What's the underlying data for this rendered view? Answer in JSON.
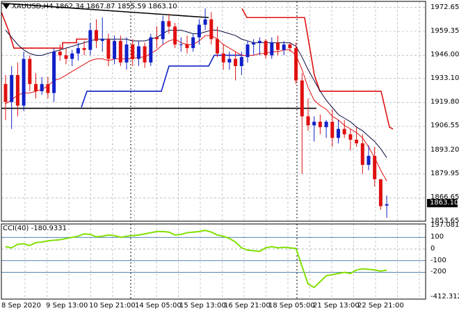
{
  "chart_title": {
    "symbol_tf": "XAUUSD,H4",
    "ohlc": "1862.34 1867.87 1855.59 1863.10"
  },
  "current_price_label": "1863.10",
  "price_axis": [
    "1972.65",
    "1959.35",
    "1946.00",
    "1933.10",
    "1919.80",
    "1906.55",
    "1893.20",
    "1879.95",
    "1866.65",
    "1853.65"
  ],
  "cci_title": "CCI(40) -180.9331",
  "cci_axis": [
    "197.0814",
    "100",
    "0",
    "-100",
    "-200",
    "-412.3125"
  ],
  "time_axis": [
    "8 Sep 2020",
    "9 Sep 13:00",
    "10 Sep 21:00",
    "14 Sep 05:00",
    "15 Sep 13:00",
    "16 Sep 21:00",
    "18 Sep 05:00",
    "21 Sep 13:00",
    "22 Sep 21:00"
  ],
  "colors": {
    "bull": "#1020c8",
    "bear": "#e01010",
    "ma_fast": "#e01010",
    "ma_slow": "#0a0a40",
    "support": "#1020c8",
    "cci": "#80e000",
    "levels": "#1c5a9a"
  },
  "chart_data": {
    "type": "candlestick",
    "symbol": "XAUUSD",
    "timeframe": "H4",
    "ylim": [
      1853.65,
      1975
    ],
    "candles": [
      {
        "o": 1930,
        "h": 1935,
        "l": 1910,
        "c": 1920
      },
      {
        "o": 1920,
        "h": 1940,
        "l": 1905,
        "c": 1935
      },
      {
        "o": 1935,
        "h": 1942,
        "l": 1912,
        "c": 1918
      },
      {
        "o": 1918,
        "h": 1948,
        "l": 1915,
        "c": 1944
      },
      {
        "o": 1944,
        "h": 1946,
        "l": 1926,
        "c": 1930
      },
      {
        "o": 1930,
        "h": 1936,
        "l": 1922,
        "c": 1926
      },
      {
        "o": 1926,
        "h": 1934,
        "l": 1924,
        "c": 1930
      },
      {
        "o": 1930,
        "h": 1934,
        "l": 1922,
        "c": 1925
      },
      {
        "o": 1925,
        "h": 1950,
        "l": 1920,
        "c": 1948
      },
      {
        "o": 1948,
        "h": 1952,
        "l": 1943,
        "c": 1946
      },
      {
        "o": 1946,
        "h": 1950,
        "l": 1941,
        "c": 1944
      },
      {
        "o": 1944,
        "h": 1949,
        "l": 1940,
        "c": 1947
      },
      {
        "o": 1947,
        "h": 1953,
        "l": 1943,
        "c": 1950
      },
      {
        "o": 1950,
        "h": 1954,
        "l": 1946,
        "c": 1949
      },
      {
        "o": 1949,
        "h": 1964,
        "l": 1946,
        "c": 1960
      },
      {
        "o": 1960,
        "h": 1966,
        "l": 1950,
        "c": 1954
      },
      {
        "o": 1954,
        "h": 1967,
        "l": 1948,
        "c": 1955
      },
      {
        "o": 1955,
        "h": 1958,
        "l": 1940,
        "c": 1944
      },
      {
        "o": 1944,
        "h": 1957,
        "l": 1941,
        "c": 1954
      },
      {
        "o": 1954,
        "h": 1957,
        "l": 1940,
        "c": 1942
      },
      {
        "o": 1942,
        "h": 1956,
        "l": 1938,
        "c": 1952
      },
      {
        "o": 1952,
        "h": 1955,
        "l": 1940,
        "c": 1944
      },
      {
        "o": 1944,
        "h": 1954,
        "l": 1940,
        "c": 1951
      },
      {
        "o": 1951,
        "h": 1953,
        "l": 1939,
        "c": 1942
      },
      {
        "o": 1942,
        "h": 1958,
        "l": 1940,
        "c": 1956
      },
      {
        "o": 1956,
        "h": 1962,
        "l": 1950,
        "c": 1955
      },
      {
        "o": 1955,
        "h": 1968,
        "l": 1952,
        "c": 1965
      },
      {
        "o": 1965,
        "h": 1969,
        "l": 1958,
        "c": 1962
      },
      {
        "o": 1962,
        "h": 1964,
        "l": 1950,
        "c": 1952
      },
      {
        "o": 1952,
        "h": 1956,
        "l": 1948,
        "c": 1952
      },
      {
        "o": 1952,
        "h": 1957,
        "l": 1947,
        "c": 1950
      },
      {
        "o": 1950,
        "h": 1958,
        "l": 1948,
        "c": 1956
      },
      {
        "o": 1956,
        "h": 1966,
        "l": 1952,
        "c": 1963
      },
      {
        "o": 1963,
        "h": 1972,
        "l": 1960,
        "c": 1966
      },
      {
        "o": 1966,
        "h": 1970,
        "l": 1952,
        "c": 1955
      },
      {
        "o": 1955,
        "h": 1962,
        "l": 1945,
        "c": 1947
      },
      {
        "o": 1947,
        "h": 1952,
        "l": 1938,
        "c": 1942
      },
      {
        "o": 1942,
        "h": 1948,
        "l": 1938,
        "c": 1944
      },
      {
        "o": 1944,
        "h": 1948,
        "l": 1932,
        "c": 1940
      },
      {
        "o": 1940,
        "h": 1948,
        "l": 1935,
        "c": 1945
      },
      {
        "o": 1945,
        "h": 1954,
        "l": 1942,
        "c": 1952
      },
      {
        "o": 1952,
        "h": 1955,
        "l": 1946,
        "c": 1953
      },
      {
        "o": 1953,
        "h": 1956,
        "l": 1946,
        "c": 1954
      },
      {
        "o": 1954,
        "h": 1955,
        "l": 1944,
        "c": 1946
      },
      {
        "o": 1946,
        "h": 1956,
        "l": 1944,
        "c": 1953
      },
      {
        "o": 1953,
        "h": 1957,
        "l": 1946,
        "c": 1949
      },
      {
        "o": 1949,
        "h": 1954,
        "l": 1946,
        "c": 1952
      },
      {
        "o": 1952,
        "h": 1953,
        "l": 1948,
        "c": 1950
      },
      {
        "o": 1950,
        "h": 1953,
        "l": 1930,
        "c": 1932
      },
      {
        "o": 1932,
        "h": 1936,
        "l": 1880,
        "c": 1912
      },
      {
        "o": 1912,
        "h": 1922,
        "l": 1904,
        "c": 1907
      },
      {
        "o": 1907,
        "h": 1912,
        "l": 1898,
        "c": 1909
      },
      {
        "o": 1909,
        "h": 1913,
        "l": 1902,
        "c": 1906
      },
      {
        "o": 1906,
        "h": 1910,
        "l": 1900,
        "c": 1909
      },
      {
        "o": 1909,
        "h": 1916,
        "l": 1895,
        "c": 1900
      },
      {
        "o": 1900,
        "h": 1910,
        "l": 1897,
        "c": 1905
      },
      {
        "o": 1905,
        "h": 1910,
        "l": 1900,
        "c": 1902
      },
      {
        "o": 1902,
        "h": 1905,
        "l": 1893,
        "c": 1899
      },
      {
        "o": 1899,
        "h": 1906,
        "l": 1895,
        "c": 1897
      },
      {
        "o": 1897,
        "h": 1902,
        "l": 1880,
        "c": 1885
      },
      {
        "o": 1885,
        "h": 1896,
        "l": 1882,
        "c": 1890
      },
      {
        "o": 1890,
        "h": 1895,
        "l": 1873,
        "c": 1877
      },
      {
        "o": 1877,
        "h": 1877,
        "l": 1860,
        "c": 1862
      },
      {
        "o": 1862.34,
        "h": 1867.87,
        "l": 1855.59,
        "c": 1863.1
      }
    ],
    "ma_fast": [
      1919,
      1921,
      1924,
      1925,
      1925,
      1926,
      1927,
      1929,
      1932,
      1933,
      1935,
      1937,
      1939,
      1941,
      1943,
      1944,
      1944,
      1943,
      1944,
      1944,
      1944,
      1944,
      1945,
      1945,
      1947,
      1949,
      1952,
      1954,
      1955,
      1953,
      1952,
      1952,
      1954,
      1957,
      1957,
      1955,
      1952,
      1950,
      1948,
      1946,
      1946,
      1946,
      1947,
      1947,
      1948,
      1948,
      1949,
      1949,
      1946,
      1938,
      1928,
      1921,
      1918,
      1916,
      1912,
      1910,
      1907,
      1905,
      1903,
      1900,
      1895,
      1889,
      1882,
      1876
    ],
    "ma_slow": [
      1960,
      1956,
      1952,
      1949,
      1947,
      1946,
      1946,
      1947,
      1948,
      1949,
      1950,
      1951,
      1952,
      1953,
      1954,
      1955,
      1955,
      1955,
      1955,
      1955,
      1955,
      1954,
      1954,
      1954,
      1955,
      1956,
      1958,
      1960,
      1960,
      1960,
      1959,
      1958,
      1958,
      1959,
      1960,
      1960,
      1959,
      1958,
      1957,
      1955,
      1954,
      1953,
      1953,
      1953,
      1953,
      1953,
      1953,
      1953,
      1951,
      1945,
      1938,
      1932,
      1926,
      1921,
      1917,
      1913,
      1911,
      1909,
      1906,
      1904,
      1901,
      1898,
      1894,
      1889
    ],
    "cci": [
      20,
      10,
      40,
      45,
      30,
      55,
      60,
      70,
      75,
      80,
      90,
      100,
      110,
      130,
      125,
      105,
      110,
      120,
      115,
      100,
      110,
      115,
      120,
      130,
      140,
      150,
      150,
      145,
      120,
      125,
      140,
      145,
      150,
      160,
      145,
      120,
      110,
      90,
      60,
      10,
      -10,
      -15,
      -20,
      10,
      20,
      10,
      15,
      10,
      5,
      -150,
      -300,
      -330,
      -280,
      -230,
      -220,
      -210,
      -200,
      -210,
      -180,
      -170,
      -175,
      -180,
      -190,
      -181
    ],
    "cci_levels": [
      100,
      0,
      -100,
      -200
    ]
  }
}
